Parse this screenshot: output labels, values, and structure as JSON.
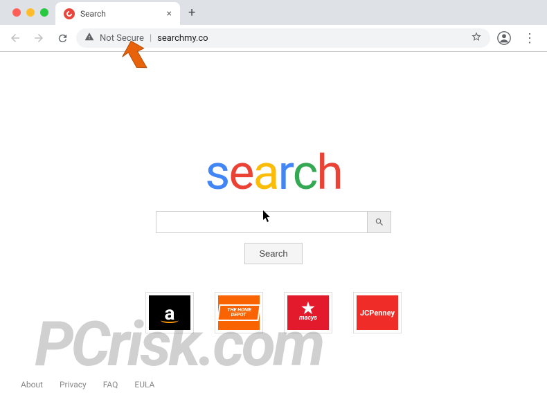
{
  "browser": {
    "tab_title": "Search",
    "security_label": "Not Secure",
    "url": "searchmy.co"
  },
  "page": {
    "logo_letters": [
      "s",
      "e",
      "a",
      "r",
      "c",
      "h"
    ],
    "search_button": "Search",
    "search_placeholder": ""
  },
  "tiles": [
    {
      "name": "amazon",
      "label": "a"
    },
    {
      "name": "homedepot",
      "label": "THE HOME DEPOT"
    },
    {
      "name": "macys",
      "star": "★",
      "label": "macys"
    },
    {
      "name": "jcpenney",
      "label": "JCPenney"
    }
  ],
  "footer": {
    "links": [
      "About",
      "Privacy",
      "FAQ",
      "EULA"
    ]
  },
  "watermark": "PCrisk.com"
}
